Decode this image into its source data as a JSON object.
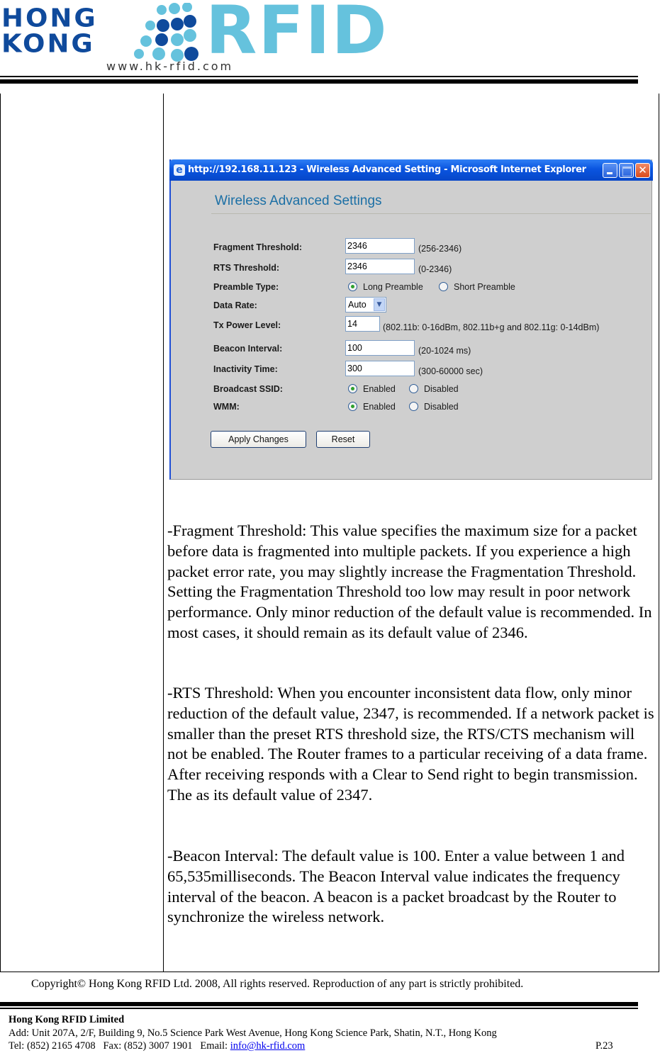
{
  "header": {
    "logo_line1": "HONG",
    "logo_line2": "KONG",
    "logo_brand": "RFID",
    "logo_url": "www.hk-rfid.com",
    "colors": {
      "dark_blue": "#0f4a9c",
      "light_blue": "#65c2dd"
    }
  },
  "screenshot": {
    "window_title": "http://192.168.11.123 - Wireless Advanced Setting - Microsoft Internet Explorer",
    "window_buttons": [
      "minimize",
      "maximize",
      "close"
    ],
    "close_glyph": "✕",
    "ie_icon_glyph": "e",
    "page_heading": "Wireless Advanced Settings",
    "fields": {
      "fragment_threshold": {
        "label": "Fragment Threshold:",
        "value": "2346",
        "hint": "(256-2346)"
      },
      "rts_threshold": {
        "label": "RTS Threshold:",
        "value": "2346",
        "hint": "(0-2346)"
      },
      "preamble_type": {
        "label": "Preamble Type:",
        "options": [
          "Long Preamble",
          "Short Preamble"
        ],
        "selected": "Long Preamble"
      },
      "data_rate": {
        "label": "Data Rate:",
        "value": "Auto",
        "arrow_glyph": "▼"
      },
      "tx_power_level": {
        "label": "Tx Power Level:",
        "value": "14",
        "hint": "(802.11b: 0-16dBm, 802.11b+g and 802.11g: 0-14dBm)"
      },
      "beacon_interval": {
        "label": "Beacon Interval:",
        "value": "100",
        "hint": "(20-1024 ms)"
      },
      "inactivity_time": {
        "label": "Inactivity Time:",
        "value": "300",
        "hint": "(300-60000 sec)"
      },
      "broadcast_ssid": {
        "label": "Broadcast SSID:",
        "options": [
          "Enabled",
          "Disabled"
        ],
        "selected": "Enabled"
      },
      "wmm": {
        "label": "WMM:",
        "options": [
          "Enabled",
          "Disabled"
        ],
        "selected": "Enabled"
      }
    },
    "buttons": {
      "apply": "Apply Changes",
      "reset": "Reset"
    }
  },
  "body": {
    "paragraphs": [
      "-Fragment Threshold: This value specifies the maximum size for a packet before data is fragmented into multiple packets. If you experience a high packet error rate, you may slightly increase the Fragmentation Threshold. Setting the Fragmentation Threshold too low may result in poor network performance. Only minor reduction of the default value is recommended. In most cases, it should remain as its default value of 2346.",
      "-RTS Threshold: When you encounter inconsistent data flow, only minor reduction of the default value, 2347, is recommended. If a network packet is smaller than the preset RTS threshold size, the RTS/CTS mechanism will not be enabled. The Router frames to a particular receiving of a data frame. After receiving responds with a Clear to Send right to begin transmission. The as its default value of 2347.",
      "-Beacon Interval: The default value is 100. Enter a value between 1 and 65,535milliseconds. The Beacon Interval value indicates the frequency interval of the beacon. A beacon is a packet broadcast by the Router to synchronize the wireless network."
    ]
  },
  "footer": {
    "copyright": "Copyright© Hong Kong RFID Ltd. 2008, All rights reserved. Reproduction of any part is strictly prohibited.",
    "company": "Hong Kong RFID Limited",
    "address": "Add: Unit 207A, 2/F, Building 9, No.5 Science Park West Avenue, Hong Kong Science Park, Shatin, N.T., Hong Kong",
    "tel_fax": "Tel: (852) 2165 4708   Fax: (852) 3007 1901   Email: ",
    "email": "info@hk-rfid.com",
    "page": "P.23"
  }
}
